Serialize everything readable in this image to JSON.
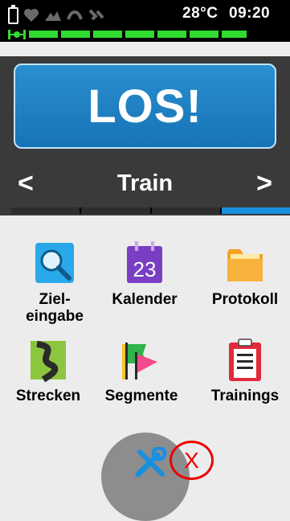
{
  "status_bar": {
    "temperature": "28°C",
    "time": "09:20",
    "icons": [
      "battery-icon",
      "heart-rate-icon",
      "cadence-icon",
      "speed-sensor-icon",
      "power-sensor-icon",
      "gps-signal-icon"
    ]
  },
  "los": {
    "label": "LOS!"
  },
  "profile": {
    "name": "Train",
    "prev_arrow": "<",
    "next_arrow": ">",
    "page_indicator_active": 4,
    "page_count": 4
  },
  "apps": [
    {
      "label": "Ziel-\neingabe",
      "icon": "search-icon"
    },
    {
      "label": "Kalender",
      "icon": "calendar-icon",
      "day": "23"
    },
    {
      "label": "Protokoll",
      "icon": "folder-icon"
    },
    {
      "label": "Strecken",
      "icon": "route-icon"
    },
    {
      "label": "Segmente",
      "icon": "segment-flag-icon"
    },
    {
      "label": "Trainings",
      "icon": "clipboard-icon"
    }
  ],
  "footer": {
    "settings_icon": "wrench-screwdriver-icon",
    "overlay_mark": "X"
  },
  "colors": {
    "accent": "#1a8fe0",
    "signal": "#2fdc2f",
    "overlay": "#e00000"
  }
}
